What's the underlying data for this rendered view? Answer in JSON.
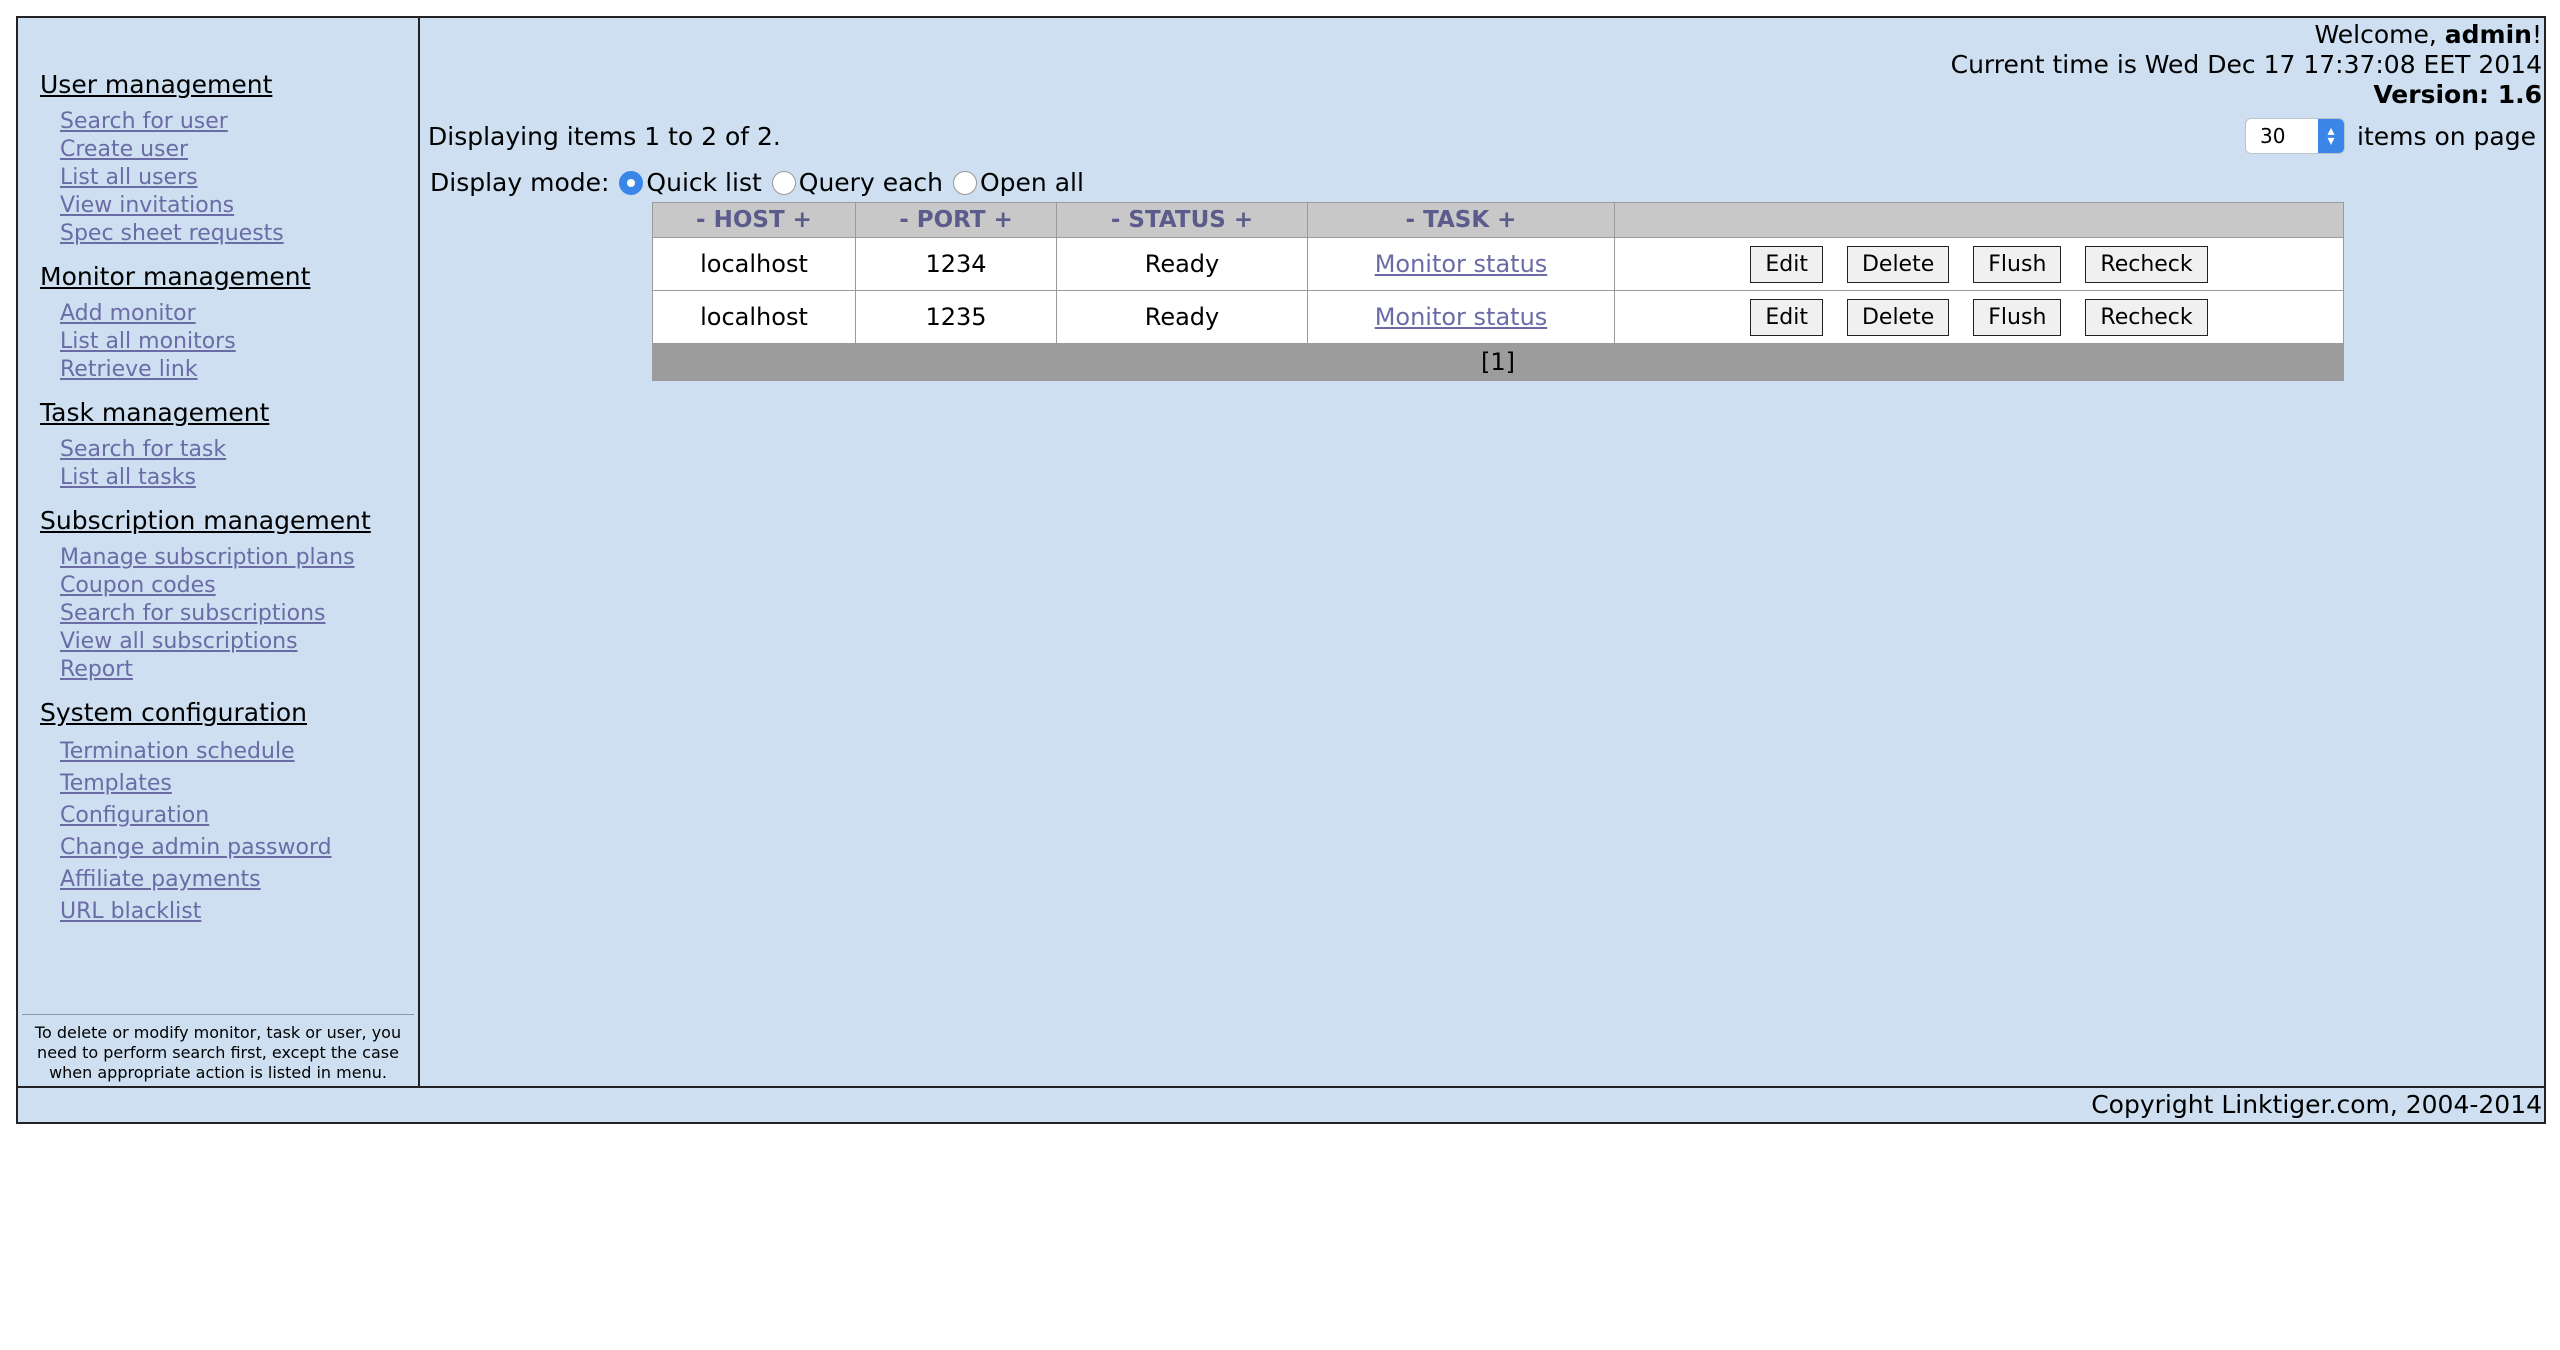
{
  "sidebar": {
    "sections": [
      {
        "title": "User management",
        "items": [
          "Search for user",
          "Create user",
          "List all users",
          "View invitations",
          "Spec sheet requests"
        ]
      },
      {
        "title": "Monitor management",
        "items": [
          "Add monitor",
          "List all monitors",
          "Retrieve link"
        ]
      },
      {
        "title": "Task management",
        "items": [
          "Search for task",
          "List all tasks"
        ]
      },
      {
        "title": "Subscription management",
        "items": [
          "Manage subscription plans",
          "Coupon codes",
          "Search for subscriptions",
          "View all subscriptions",
          "Report"
        ]
      },
      {
        "title": "System configuration",
        "items": [
          "Termination schedule",
          "Templates",
          "Configuration",
          "Change admin password",
          "Affiliate payments",
          "URL blacklist"
        ]
      }
    ],
    "note": "To delete or modify monitor, task or user, you need to perform search first, except the case when appropriate action is listed in menu."
  },
  "header": {
    "welcome_prefix": "Welcome, ",
    "username": "admin",
    "welcome_suffix": "!",
    "current_time": "Current time is Wed Dec 17 17:37:08 EET 2014",
    "version": "Version: 1.6"
  },
  "listing": {
    "displaying": "Displaying items 1 to 2 of 2.",
    "items_per_page_value": "30",
    "items_per_page_label": "items on page",
    "display_mode_label": "Display mode:",
    "modes": [
      "Quick list",
      "Query each",
      "Open all"
    ],
    "selected_mode": "Quick list"
  },
  "table": {
    "columns": [
      "- HOST +",
      "- PORT +",
      "- STATUS +",
      "- TASK +",
      ""
    ],
    "rows": [
      {
        "host": "localhost",
        "port": "1234",
        "status": "Ready",
        "task": "Monitor status"
      },
      {
        "host": "localhost",
        "port": "1235",
        "status": "Ready",
        "task": "Monitor status"
      }
    ],
    "actions": [
      "Edit",
      "Delete",
      "Flush",
      "Recheck"
    ],
    "pager": "[1]"
  },
  "footer": {
    "copyright": "Copyright Linktiger.com, 2004-2014"
  }
}
